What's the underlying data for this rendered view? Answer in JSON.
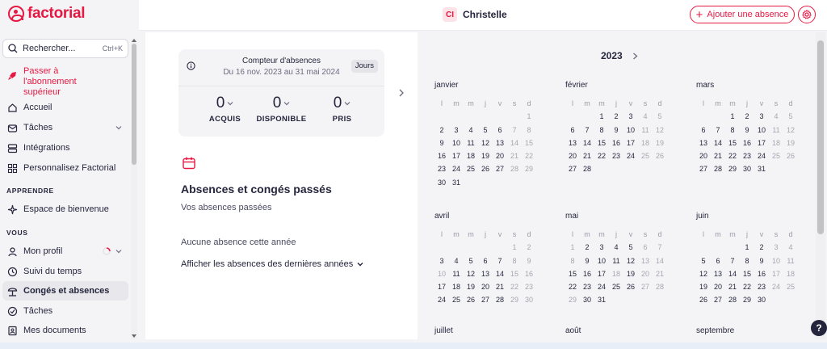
{
  "app": {
    "name": "factorial"
  },
  "search": {
    "label": "Rechercher...",
    "shortcut": "Ctrl+K"
  },
  "sidebar": {
    "upgrade": "Passer à l'abonnement supérieur",
    "items_top": [
      {
        "label": "Accueil",
        "icon": "home-icon"
      },
      {
        "label": "Tâches",
        "icon": "inbox-icon"
      },
      {
        "label": "Intégrations",
        "icon": "integrations-icon"
      },
      {
        "label": "Personnalisez Factorial",
        "icon": "grid-icon"
      }
    ],
    "section_apprendre": "APPRENDRE",
    "items_apprendre": [
      {
        "label": "Espace de bienvenue",
        "icon": "sparkle-icon"
      }
    ],
    "section_vous": "VOUS",
    "items_vous": [
      {
        "label": "Mon profil",
        "icon": "person-icon"
      },
      {
        "label": "Suivi du temps",
        "icon": "clock-icon"
      },
      {
        "label": "Congés et absences",
        "icon": "beach-icon"
      },
      {
        "label": "Tâches",
        "icon": "check-circle-icon"
      },
      {
        "label": "Mes documents",
        "icon": "document-icon"
      }
    ]
  },
  "header": {
    "user_initials": "CI",
    "user_name": "Christelle",
    "add_button": "Ajouter une absence"
  },
  "counter": {
    "title": "Compteur d'absences",
    "period": "Du 16 nov. 2023 au 31 mai 2024",
    "unit": "Jours",
    "stats": [
      {
        "value": "0",
        "label": "ACQUIS"
      },
      {
        "value": "0",
        "label": "DISPONIBLE"
      },
      {
        "value": "0",
        "label": "PRIS"
      }
    ]
  },
  "past": {
    "title": "Absences et congés passés",
    "subtitle": "Vos absences passées",
    "none": "Aucune absence cette année",
    "link": "Afficher les absences des dernières années"
  },
  "calendar": {
    "year": "2023",
    "weekdays": [
      "l",
      "m",
      "m",
      "j",
      "v",
      "s",
      "d"
    ],
    "months": [
      {
        "name": "janvier",
        "offset": 6,
        "days": 31
      },
      {
        "name": "février",
        "offset": 2,
        "days": 28
      },
      {
        "name": "mars",
        "offset": 2,
        "days": 31
      },
      {
        "name": "avril",
        "offset": 5,
        "days": 30
      },
      {
        "name": "mai",
        "offset": 0,
        "days": 31
      },
      {
        "name": "juin",
        "offset": 3,
        "days": 30
      },
      {
        "name": "juillet",
        "offset": 5,
        "days": 0
      },
      {
        "name": "août",
        "offset": 1,
        "days": 0
      },
      {
        "name": "septembre",
        "offset": 4,
        "days": 0
      }
    ],
    "holidays": {
      "janvier": [
        1
      ],
      "avril": [
        10
      ],
      "mai": [
        1,
        8,
        18,
        29
      ]
    }
  },
  "help": "?",
  "colors": {
    "brand": "#e51943",
    "text": "#25253d",
    "muted": "#a6a6b2"
  }
}
